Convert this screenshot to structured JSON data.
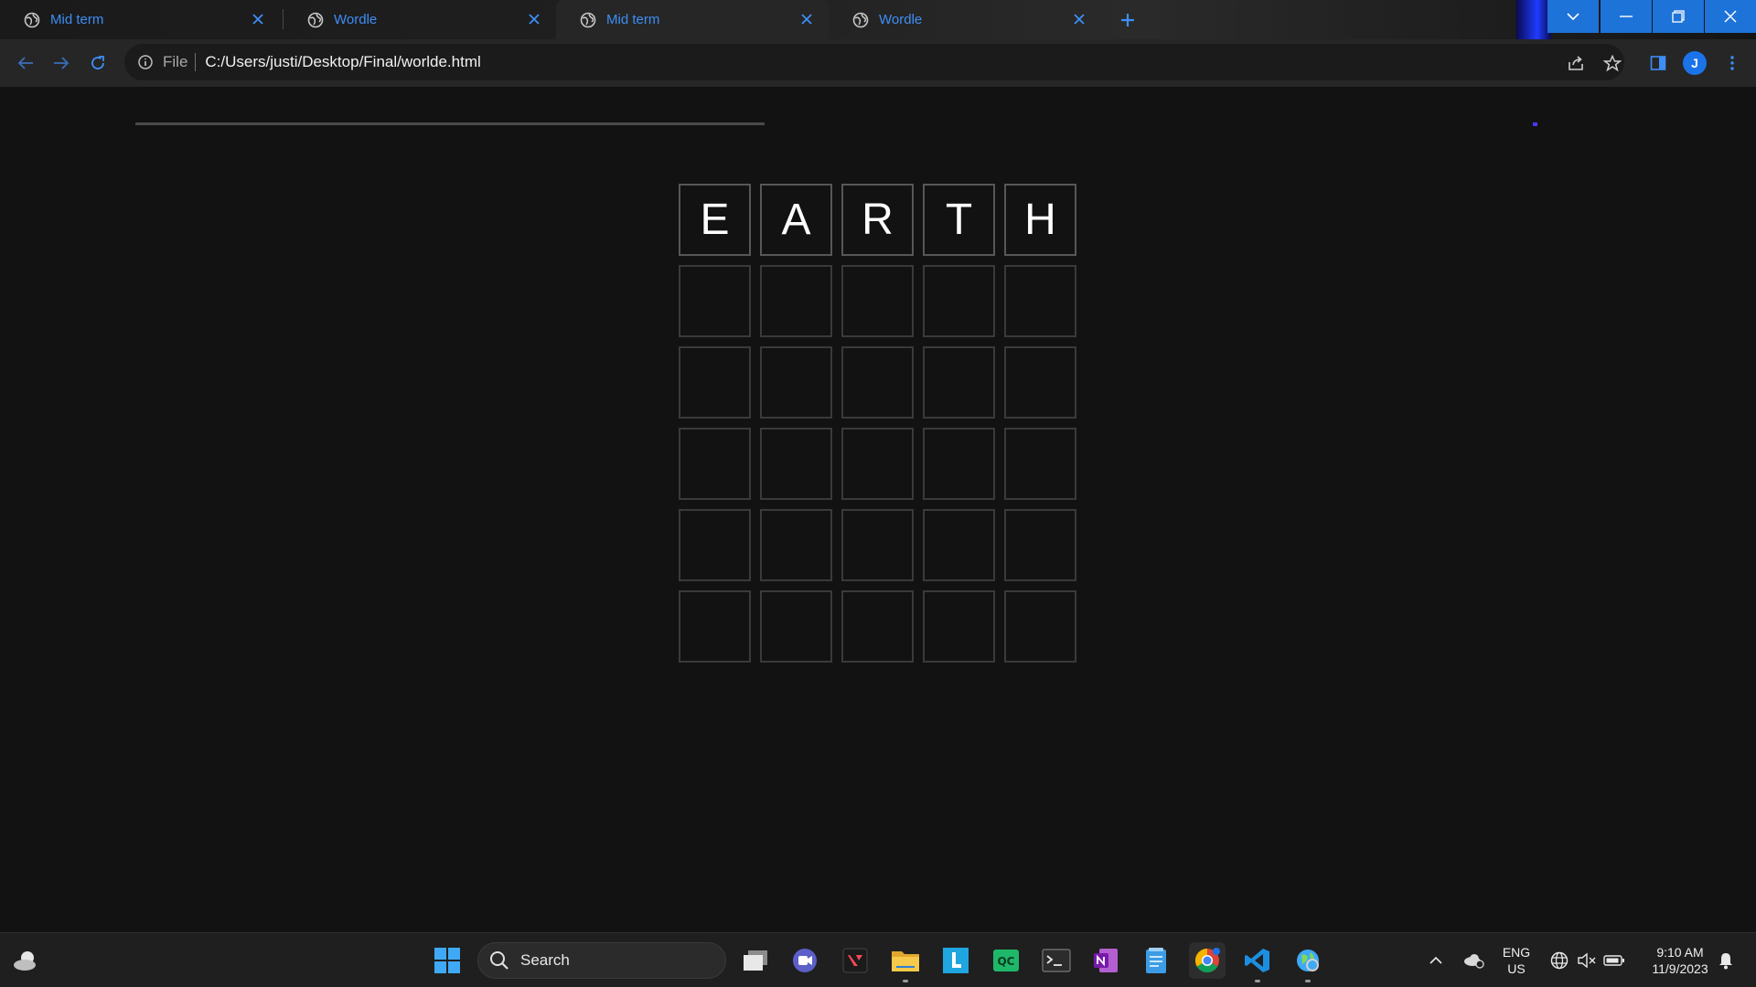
{
  "browser": {
    "tabs": [
      {
        "title": "Mid term"
      },
      {
        "title": "Wordle"
      },
      {
        "title": "Mid term"
      },
      {
        "title": "Wordle"
      }
    ],
    "address": {
      "scheme_label": "File",
      "url": "C:/Users/justi/Desktop/Final/worlde.html"
    },
    "profile_initial": "J"
  },
  "game": {
    "board": [
      [
        "E",
        "A",
        "R",
        "T",
        "H"
      ],
      [
        "",
        "",
        "",
        "",
        ""
      ],
      [
        "",
        "",
        "",
        "",
        ""
      ],
      [
        "",
        "",
        "",
        "",
        ""
      ],
      [
        "",
        "",
        "",
        "",
        ""
      ],
      [
        "",
        "",
        "",
        "",
        ""
      ]
    ]
  },
  "taskbar": {
    "search_label": "Search",
    "language": {
      "line1": "ENG",
      "line2": "US"
    },
    "clock": {
      "time": "9:10 AM",
      "date": "11/9/2023"
    },
    "pinned_apps": [
      "task-view",
      "meet",
      "valorant",
      "file-explorer",
      "libby",
      "qc",
      "terminal",
      "onenote",
      "notepad",
      "chrome",
      "vscode",
      "web-app"
    ]
  },
  "colors": {
    "page_bg": "#121212",
    "tile_border": "#3a3a3c",
    "tab_text": "#3d8ef7",
    "window_controls": "#1e73d8"
  }
}
